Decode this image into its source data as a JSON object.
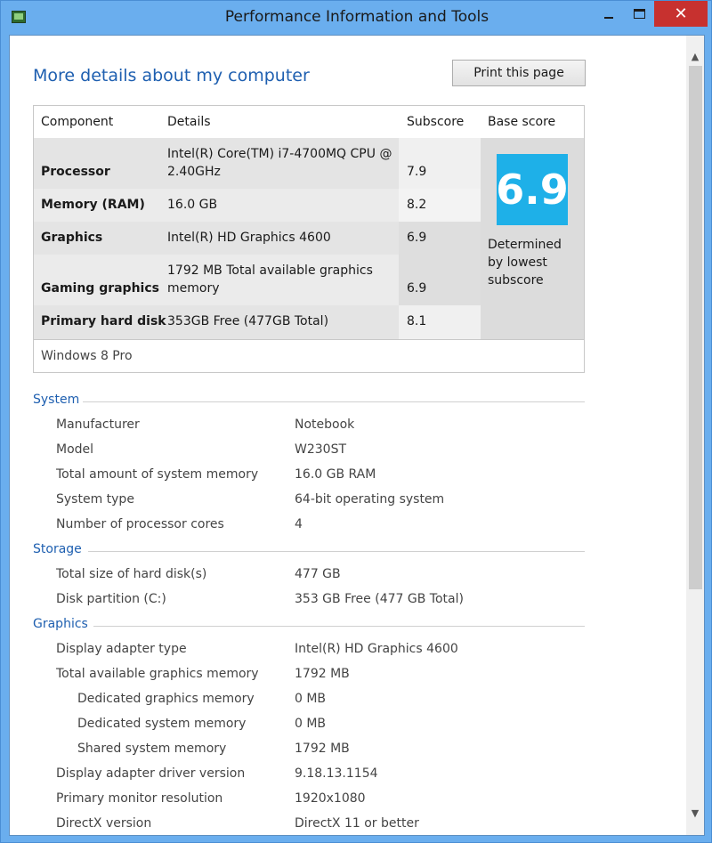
{
  "window": {
    "title": "Performance Information and Tools",
    "close_glyph": "✕"
  },
  "page": {
    "heading": "More details about my computer",
    "print_button": "Print this page"
  },
  "score_table": {
    "headers": [
      "Component",
      "Details",
      "Subscore",
      "Base score"
    ],
    "rows": [
      {
        "component": "Processor",
        "details": "Intel(R) Core(TM) i7-4700MQ CPU @ 2.40GHz",
        "subscore": "7.9"
      },
      {
        "component": "Memory (RAM)",
        "details": "16.0 GB",
        "subscore": "8.2"
      },
      {
        "component": "Graphics",
        "details": "Intel(R) HD Graphics 4600",
        "subscore": "6.9"
      },
      {
        "component": "Gaming graphics",
        "details": "1792 MB Total available graphics memory",
        "subscore": "6.9"
      },
      {
        "component": "Primary hard disk",
        "details": "353GB Free (477GB Total)",
        "subscore": "8.1"
      }
    ],
    "base_score": "6.9",
    "base_note": "Determined by lowest subscore",
    "base_tile_color": "#1eb0e8",
    "edition": "Windows 8 Pro"
  },
  "sections": {
    "system": {
      "title": "System",
      "items": [
        {
          "label": "Manufacturer",
          "value": "Notebook"
        },
        {
          "label": "Model",
          "value": "W230ST"
        },
        {
          "label": "Total amount of system memory",
          "value": "16.0 GB RAM"
        },
        {
          "label": "System type",
          "value": "64-bit operating system"
        },
        {
          "label": "Number of processor cores",
          "value": "4"
        }
      ]
    },
    "storage": {
      "title": "Storage",
      "items": [
        {
          "label": "Total size of hard disk(s)",
          "value": "477 GB"
        },
        {
          "label": "Disk partition (C:)",
          "value": "353 GB Free (477 GB Total)"
        }
      ]
    },
    "graphics": {
      "title": "Graphics",
      "items": [
        {
          "label": "Display adapter type",
          "value": "Intel(R) HD Graphics 4600"
        },
        {
          "label": "Total available graphics memory",
          "value": "1792 MB"
        },
        {
          "label": "Dedicated graphics memory",
          "value": "0 MB"
        },
        {
          "label": "Dedicated system memory",
          "value": "0 MB"
        },
        {
          "label": "Shared system memory",
          "value": "1792 MB"
        },
        {
          "label": "Display adapter driver version",
          "value": "9.18.13.1154"
        },
        {
          "label": "Primary monitor resolution",
          "value": "1920x1080"
        },
        {
          "label": "DirectX version",
          "value": "DirectX 11 or better"
        }
      ]
    }
  },
  "colors": {
    "accent": "#1e5fb0",
    "title_bar": "#6aaeee",
    "close_button": "#c7312f"
  }
}
